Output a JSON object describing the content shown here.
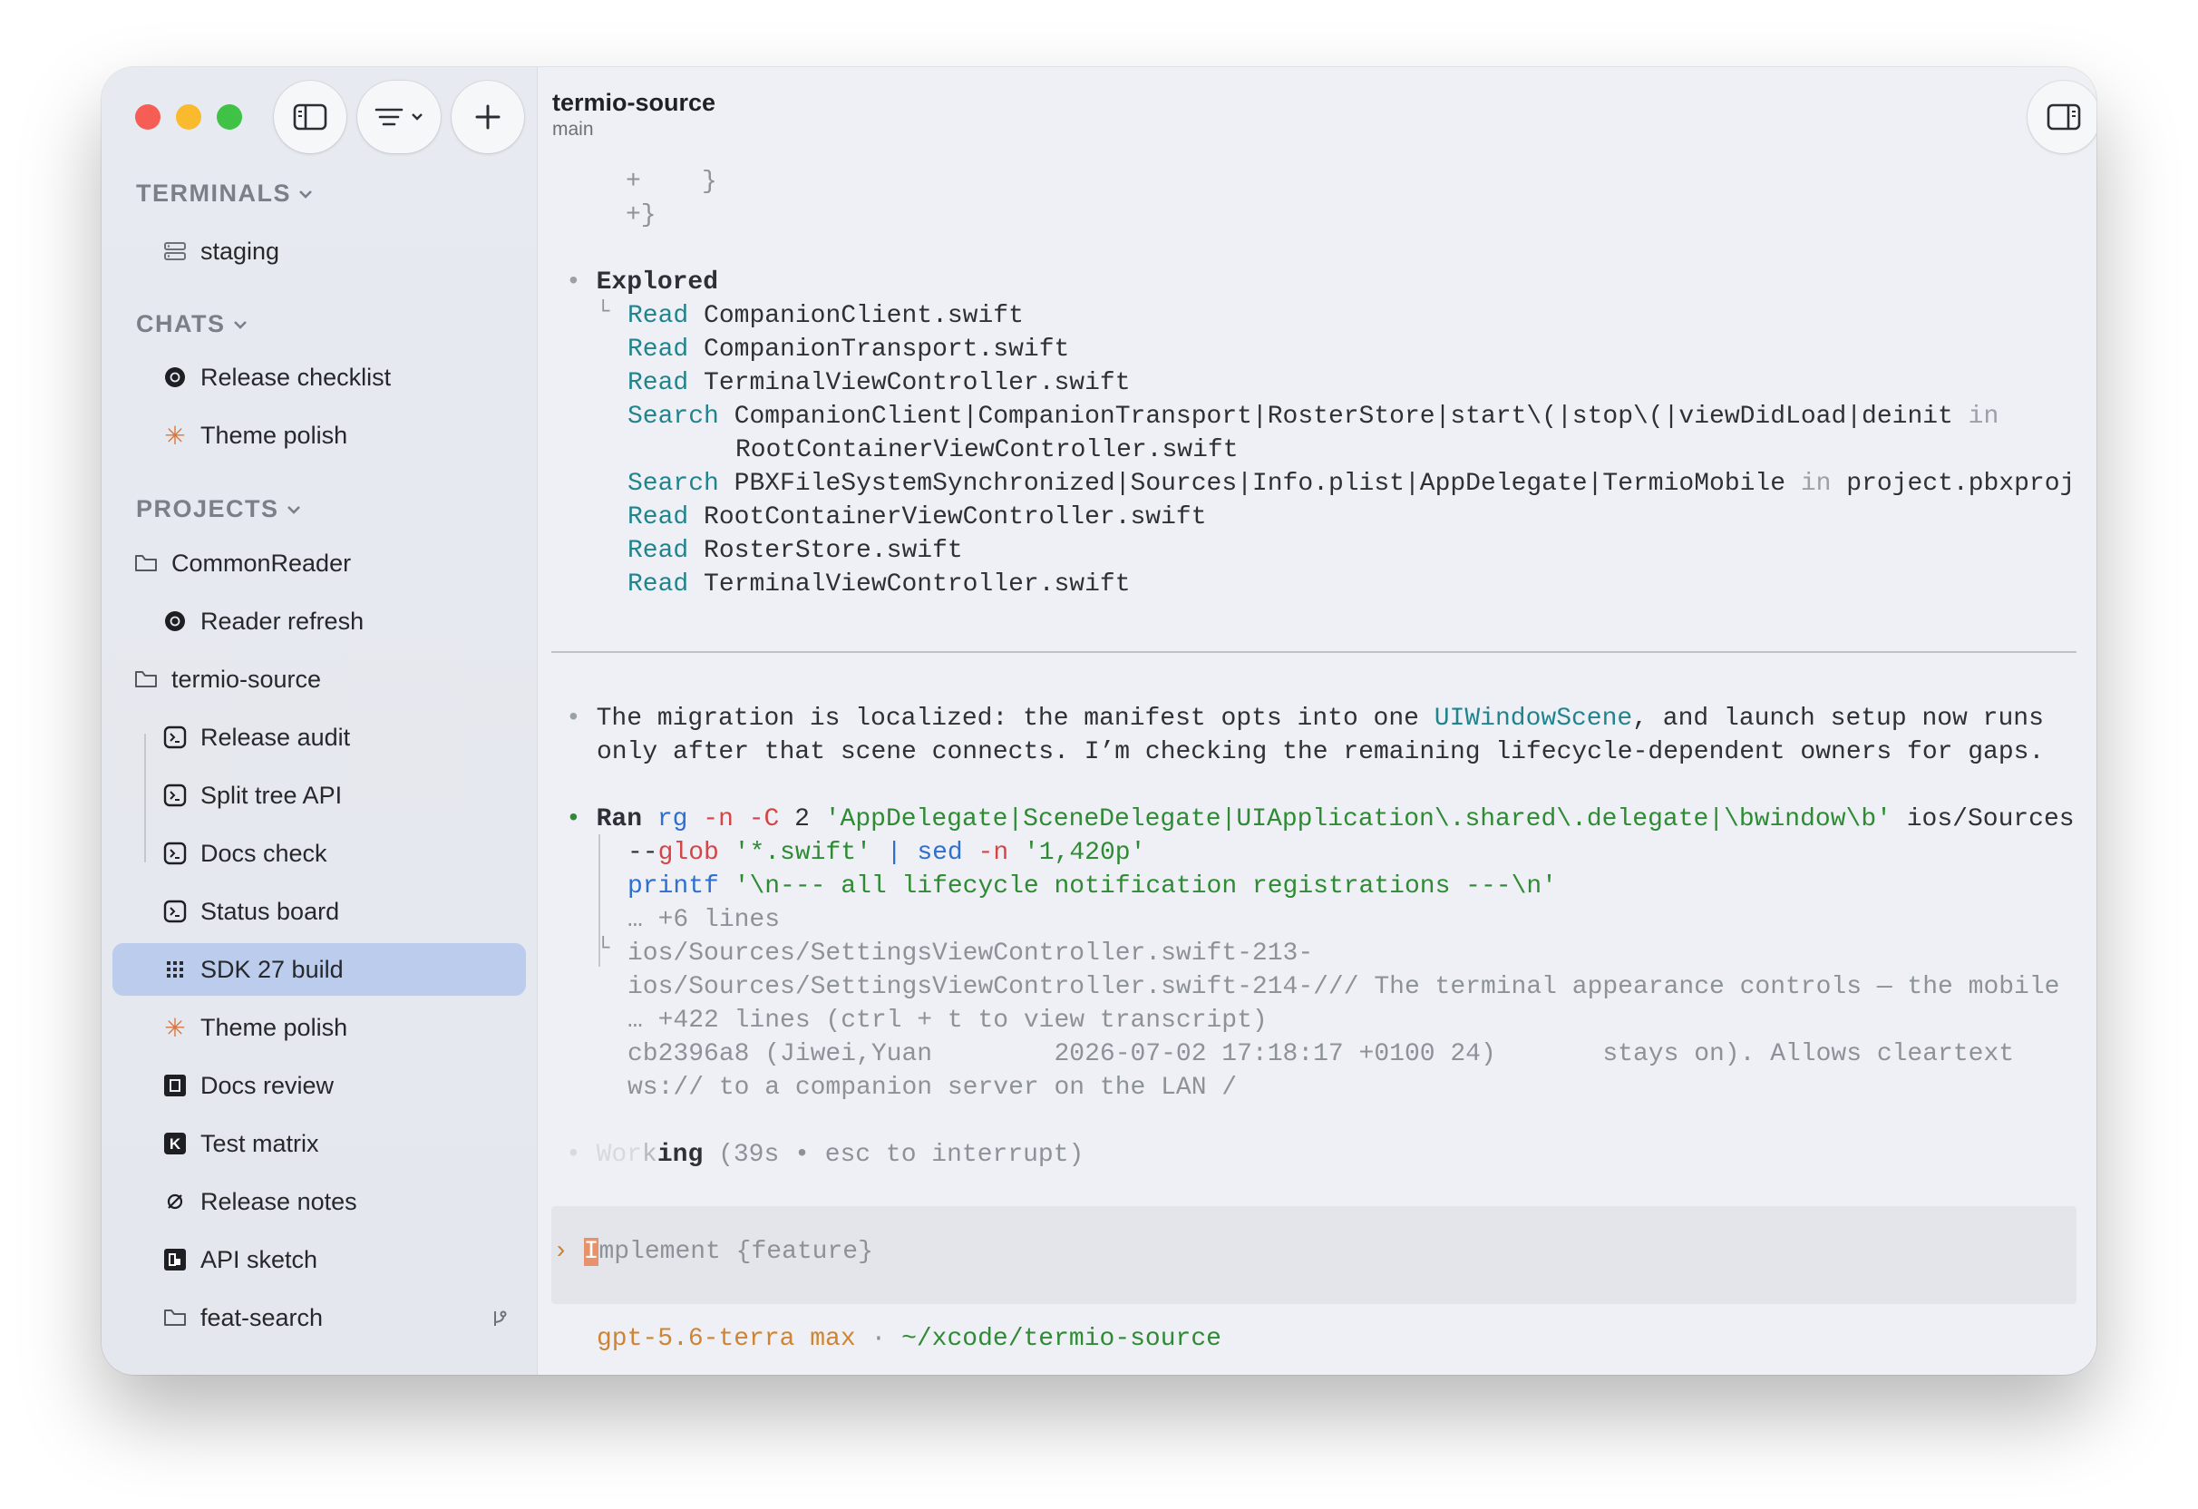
{
  "sidebar": {
    "sections": {
      "terminals": "TERMINALS",
      "chats": "CHATS",
      "projects": "PROJECTS"
    },
    "terminals": [
      {
        "label": "staging",
        "icon": "server-icon"
      }
    ],
    "chats": [
      {
        "label": "Release checklist",
        "icon": "openai-icon"
      },
      {
        "label": "Theme polish",
        "icon": "sparkle-icon"
      }
    ],
    "projects": [
      {
        "label": "CommonReader",
        "icon": "folder-icon"
      },
      {
        "label": "Reader refresh",
        "icon": "openai-icon"
      },
      {
        "label": "termio-source",
        "icon": "folder-icon"
      },
      {
        "label": "Release audit",
        "icon": "terminal-icon"
      },
      {
        "label": "Split tree API",
        "icon": "terminal-icon"
      },
      {
        "label": "Docs check",
        "icon": "terminal-icon"
      },
      {
        "label": "Status board",
        "icon": "terminal-icon"
      },
      {
        "label": "SDK 27 build",
        "icon": "grid-icon",
        "selected": true
      },
      {
        "label": "Theme polish",
        "icon": "sparkle-icon"
      },
      {
        "label": "Docs review",
        "icon": "square-icon"
      },
      {
        "label": "Test matrix",
        "icon": "k-icon"
      },
      {
        "label": "Release notes",
        "icon": "loop-icon"
      },
      {
        "label": "API sketch",
        "icon": "dev-icon"
      },
      {
        "label": "feat-search",
        "icon": "folder-icon"
      }
    ]
  },
  "header": {
    "title": "termio-source",
    "subtitle": "main"
  },
  "terminal": {
    "diff_lines": [
      "+    }",
      "+}"
    ],
    "explored": {
      "heading": "Explored",
      "entries": [
        {
          "verb": "Read",
          "target": "CompanionClient.swift"
        },
        {
          "verb": "Read",
          "target": "CompanionTransport.swift"
        },
        {
          "verb": "Read",
          "target": "TerminalViewController.swift"
        },
        {
          "verb": "Search",
          "target": "CompanionClient|CompanionTransport|RosterStore|start\\(|stop\\(|viewDidLoad|deinit",
          "in_word": "in",
          "target2": "RootContainerViewController.swift"
        },
        {
          "verb": "Search",
          "target": "PBXFileSystemSynchronized|Sources|Info.plist|AppDelegate|TermioMobile",
          "in_word": "in",
          "target2": "project.pbxproj"
        },
        {
          "verb": "Read",
          "target": "RootContainerViewController.swift"
        },
        {
          "verb": "Read",
          "target": "RosterStore.swift"
        },
        {
          "verb": "Read",
          "target": "TerminalViewController.swift"
        }
      ]
    },
    "message": {
      "part1": "The migration is localized: the manifest opts into one ",
      "highlight": "UIWindowScene",
      "part2": ", and launch setup now runs",
      "line2": "only after that scene connects. I’m checking the remaining lifecycle-dependent owners for gaps."
    },
    "ran": {
      "label": "Ran",
      "cmd": "rg",
      "flag1": "-n",
      "flag2": "-C",
      "num": "2",
      "pattern": "'AppDelegate|SceneDelegate|UIApplication\\.shared\\.delegate|\\bwindow\\b'",
      "path": "ios/Sources",
      "glob_dash": "--",
      "glob": "glob",
      "glob_pattern": "'*.swift'",
      "pipe": "|",
      "sed": "sed",
      "sed_flag": "-n",
      "sed_arg": "'1,420p'",
      "printf": "printf",
      "printf_arg": "'\\n--- all lifecycle notification registrations ---\\n'",
      "more1": "… +6 lines",
      "out1": "ios/Sources/SettingsViewController.swift-213-",
      "out2": "ios/Sources/SettingsViewController.swift-214-/// The terminal appearance controls — the mobile",
      "more2": "… +422 lines (ctrl + t to view transcript)",
      "out3": "cb2396a8 (Jiwei,Yuan        2026-07-02 17:18:17 +0100 24)       stays on). Allows cleartext",
      "out4": "ws:// to a companion server on the LAN /"
    },
    "working": {
      "light": "Wor",
      "mid": "k",
      "bold": "ing",
      "rest": " (39s • esc to interrupt)"
    },
    "composer": {
      "prompt": "›",
      "cursor": "I",
      "placeholder": "mplement {feature}"
    },
    "status": {
      "model": "gpt-5.6-terra max",
      "sep": " · ",
      "path": "~/xcode/termio-source"
    }
  }
}
